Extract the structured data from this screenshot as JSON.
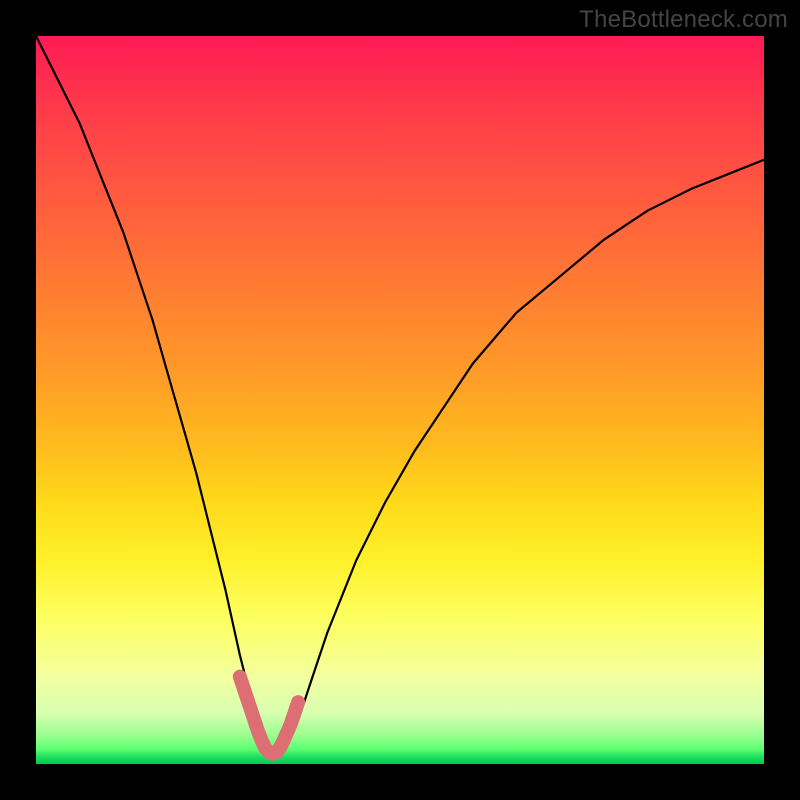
{
  "watermark": {
    "text": "TheBottleneck.com"
  },
  "chart_data": {
    "type": "line",
    "title": "",
    "xlabel": "",
    "ylabel": "",
    "xlim": [
      0,
      100
    ],
    "ylim": [
      0,
      100
    ],
    "grid": false,
    "legend": false,
    "series": [
      {
        "name": "bottleneck-curve",
        "x": [
          0,
          2,
          4,
          6,
          8,
          10,
          12,
          14,
          16,
          18,
          20,
          22,
          24,
          26,
          28,
          30,
          31,
          32,
          33,
          34,
          36,
          38,
          40,
          44,
          48,
          52,
          56,
          60,
          66,
          72,
          78,
          84,
          90,
          95,
          100
        ],
        "values": [
          100,
          96,
          92,
          88,
          83,
          78,
          73,
          67,
          61,
          54,
          47,
          40,
          32,
          24,
          15,
          7,
          4,
          2,
          1,
          2,
          6,
          12,
          18,
          28,
          36,
          43,
          49,
          55,
          62,
          67,
          72,
          76,
          79,
          81,
          83
        ]
      }
    ],
    "highlight": {
      "name": "valley-highlight",
      "color": "#dd6e74",
      "x": [
        28,
        29,
        30,
        30.5,
        31,
        31.5,
        32,
        32.5,
        33,
        33.5,
        34,
        35,
        36
      ],
      "values": [
        12,
        9,
        6,
        4.5,
        3.2,
        2.2,
        1.6,
        1.4,
        1.6,
        2.2,
        3.2,
        5.5,
        8.5
      ]
    },
    "background_gradient": {
      "top_color": "#ff1a55",
      "mid_color": "#ffd91a",
      "bottom_color": "#00c94f"
    }
  }
}
